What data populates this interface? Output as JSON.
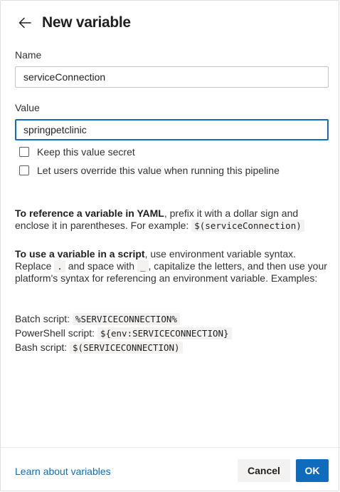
{
  "dialog": {
    "title": "New variable",
    "back_icon": "arrow-left-icon"
  },
  "fields": {
    "name": {
      "label": "Name",
      "value": "serviceConnection"
    },
    "value": {
      "label": "Value",
      "value": "springpetclinic"
    }
  },
  "options": {
    "keep_secret": {
      "label": "Keep this value secret",
      "checked": false
    },
    "allow_override": {
      "label": "Let users override this value when running this pipeline",
      "checked": false
    }
  },
  "help": {
    "yaml": {
      "bold": "To reference a variable in YAML",
      "text": ", prefix it with a dollar sign and enclose it in parentheses. For example:",
      "code": "$(serviceConnection)"
    },
    "script": {
      "bold": "To use a variable in a script",
      "text1": ", use environment variable syntax. Replace",
      "code_dot": ".",
      "text2": "and space with",
      "code_underscore": "_",
      "text3": ", capitalize the letters, and then use your platform's syntax for referencing an environment variable. Examples:"
    },
    "examples": [
      {
        "label": "Batch script:",
        "code": "%SERVICECONNECTION%"
      },
      {
        "label": "PowerShell script:",
        "code": "${env:SERVICECONNECTION}"
      },
      {
        "label": "Bash script:",
        "code": "$(SERVICECONNECTION)"
      }
    ]
  },
  "footer": {
    "learn_link": "Learn about variables",
    "cancel_label": "Cancel",
    "ok_label": "OK"
  },
  "colors": {
    "accent": "#0f6cbd",
    "text": "#201f1e",
    "code_bg": "#f3f2f1"
  }
}
